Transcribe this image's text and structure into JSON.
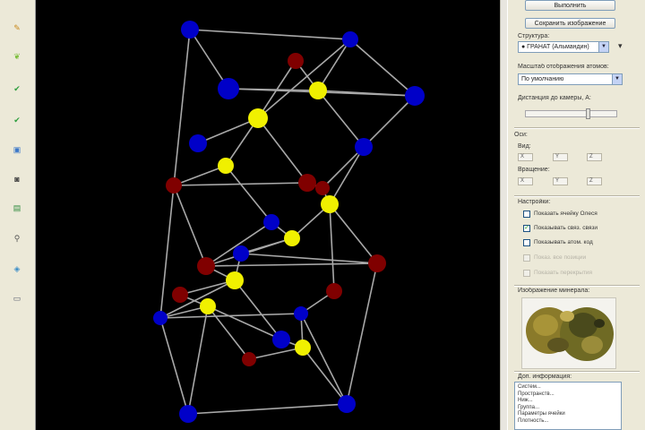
{
  "toolbar": {
    "tools": [
      {
        "icon": "pencil-icon",
        "glyph": "✎",
        "color": "#c98a1e"
      },
      {
        "icon": "leaf-icon",
        "glyph": "❦",
        "color": "#7fbf3f"
      },
      {
        "icon": "check-icon",
        "glyph": "✔",
        "color": "#2e9e3e"
      },
      {
        "icon": "double-check-icon",
        "glyph": "✔",
        "color": "#2e9e3e"
      },
      {
        "icon": "image-icon",
        "glyph": "▣",
        "color": "#3c78c8"
      },
      {
        "icon": "camera-icon",
        "glyph": "◙",
        "color": "#444"
      },
      {
        "icon": "document-icon",
        "glyph": "▤",
        "color": "#2e8b3e"
      },
      {
        "icon": "link-icon",
        "glyph": "⚲",
        "color": "#555"
      },
      {
        "icon": "water-icon",
        "glyph": "◈",
        "color": "#3c8ec8"
      },
      {
        "icon": "monitor-icon",
        "glyph": "▭",
        "color": "#5a6070"
      }
    ]
  },
  "viewport": {
    "background": "#000000",
    "bond_color": "#a8a8a8",
    "atom_colors": {
      "blue": "#0000c8",
      "yellow": "#f0f000",
      "red": "#800000"
    }
  },
  "panel": {
    "top_button": "Выполнить",
    "second_button": "Сохранить изображение",
    "select1_label": "Структура:",
    "select1_value": "● ГРАНАТ (Альмандин)",
    "select2_label": "Масштаб отображения атомов:",
    "select2_value": "По умолчанию",
    "slider_label": "Дистанция до камеры, Å:",
    "slider_level": 0.68,
    "axes_label": "Оси:",
    "group1_label": "Вид:",
    "group1_options": [
      "X",
      "Y",
      "Z"
    ],
    "group2_label": "Вращение:",
    "group2_options": [
      "X",
      "Y",
      "Z"
    ],
    "options_label": "Настройки:",
    "checks": [
      {
        "label": "Показать ячейку Олеся",
        "checked": false,
        "disabled": false
      },
      {
        "label": "Показывать связ. связи",
        "checked": true,
        "disabled": false
      },
      {
        "label": "Показывать атом. код",
        "checked": false,
        "disabled": false
      },
      {
        "label": "Показ. все позиции",
        "checked": false,
        "disabled": true
      },
      {
        "label": "Показать перекрытия",
        "checked": false,
        "disabled": true
      }
    ],
    "image_label": "Изображение минерала:",
    "info_label": "Доп. информация:",
    "info_lines": [
      "Систем...",
      "Пространств...",
      "Ниж...",
      "Группа...",
      "Параметры ячейки",
      "Плотность..."
    ]
  }
}
